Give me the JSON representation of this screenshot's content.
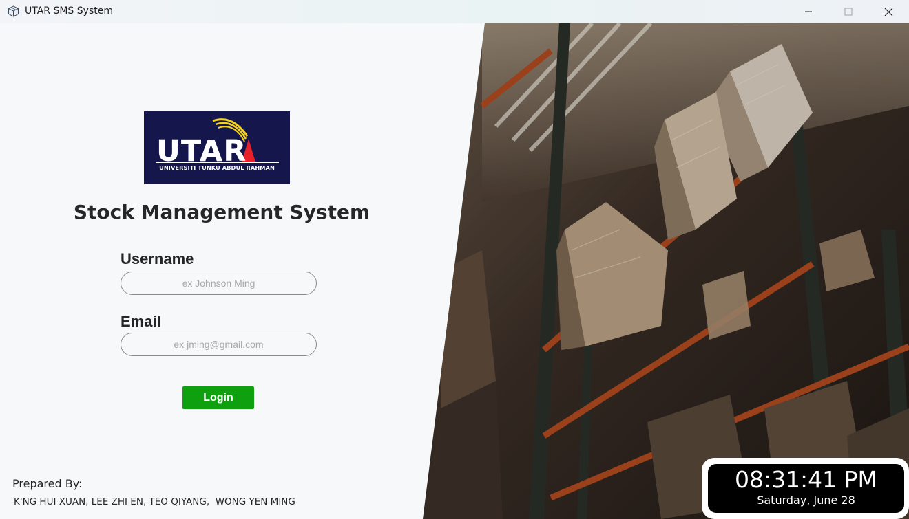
{
  "window": {
    "title": "UTAR SMS System",
    "controls": [
      "minimize-icon",
      "maximize-icon",
      "close-icon"
    ]
  },
  "logo": {
    "wordmark": "UTAR",
    "subtitle": "UNIVERSITI TUNKU ABDUL RAHMAN",
    "colors": {
      "background": "#15174c",
      "accent_red": "#e8202a",
      "accent_yellow": "#f5d21a"
    }
  },
  "login": {
    "title": "Stock Management System",
    "username_label": "Username",
    "username_placeholder": "ex Johnson Ming",
    "username_value": "",
    "email_label": "Email",
    "email_placeholder": "ex jming@gmail.com",
    "email_value": "",
    "button_label": "Login",
    "button_color": "#0fa010"
  },
  "footer": {
    "prepared_label": "Prepared By:",
    "names": "K'NG HUI XUAN, LEE ZHI EN, TEO QIYANG,  WONG YEN MING"
  },
  "clock": {
    "time": "08:31:41 PM",
    "date": "Saturday, June 28"
  }
}
